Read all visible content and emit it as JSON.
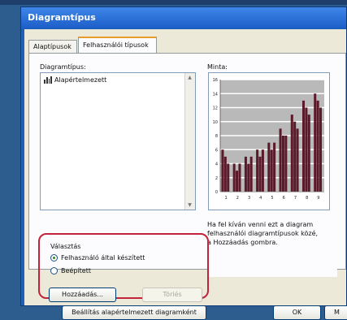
{
  "dialog": {
    "title": "Diagramtípus"
  },
  "tabs": [
    {
      "label": "Alaptípusok",
      "active": false
    },
    {
      "label": "Felhasználói típusok",
      "active": true
    }
  ],
  "type_list": {
    "label": "Diagramtípus:",
    "items": [
      {
        "label": "Alapértelmezett",
        "icon": "bar-chart-icon"
      }
    ]
  },
  "preview": {
    "label": "Minta:",
    "chart_data": {
      "type": "bar",
      "categories": [
        "1",
        "2",
        "3",
        "4",
        "5",
        "6",
        "7",
        "8",
        "9"
      ],
      "series": [
        {
          "values": [
            6,
            4,
            5,
            6,
            7,
            9,
            11,
            13,
            14
          ]
        },
        {
          "values": [
            5,
            3,
            4,
            5,
            6,
            8,
            10,
            12,
            13
          ]
        },
        {
          "values": [
            4,
            4,
            5,
            6,
            7,
            8,
            9,
            11,
            12
          ]
        }
      ],
      "ylim": [
        0,
        16
      ],
      "y_ticks": [
        "16",
        "14",
        "12",
        "10",
        "8",
        "6",
        "4",
        "2",
        "0"
      ],
      "grid": true,
      "colors": {
        "bars": "#5b1a2a",
        "plot_bg": "#b9b9b9",
        "grid": "#ffffff"
      }
    }
  },
  "description": {
    "lines": [
      "Ha fel kíván venni ezt a diagram",
      "felhasználói diagramtípusok közé,",
      "a Hozzáadás gombra."
    ]
  },
  "select_from": {
    "label": "Választás",
    "options": [
      {
        "label": "Felhasználó által készített",
        "checked": true
      },
      {
        "label": "Beépített",
        "checked": false
      }
    ]
  },
  "buttons": {
    "add": "Hozzáadás...",
    "delete": "Törlés",
    "set_default": "Beállítás alapértelmezett diagramként",
    "ok": "OK",
    "cancel": "M"
  },
  "colors": {
    "highlight": "#c2233d",
    "titlebar": "#1c5ec8"
  }
}
